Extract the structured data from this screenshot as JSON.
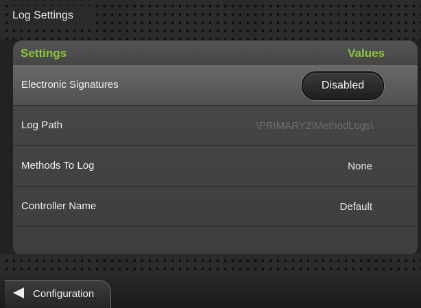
{
  "window": {
    "title": "Log Settings"
  },
  "table": {
    "header": {
      "settings": "Settings",
      "values": "Values"
    },
    "rows": [
      {
        "label": "Electronic Signatures",
        "value": "Disabled"
      },
      {
        "label": "Log Path",
        "value": "\\PRIMARY2\\MethodLogs\\"
      },
      {
        "label": "Methods To Log",
        "value": "None"
      },
      {
        "label": "Controller Name",
        "value": "Default"
      }
    ]
  },
  "nav": {
    "back_label": "Configuration"
  },
  "colors": {
    "header_accent": "#8cc63f"
  }
}
